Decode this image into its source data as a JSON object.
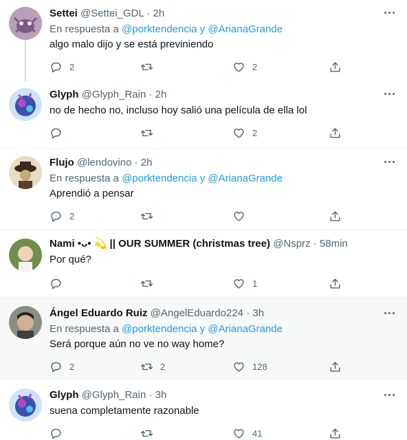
{
  "tweets": [
    {
      "name": "Settei",
      "handle": "@Settei_GDL",
      "time": "2h",
      "reply_prefix": "En respuesta a",
      "reply_users": "@porktendencia y @ArianaGrande",
      "text": "algo malo dijo y se está previniendo",
      "replies": "2",
      "retweets": "",
      "likes": "2"
    },
    {
      "name": "Glyph",
      "handle": "@Glyph_Rain",
      "time": "2h",
      "text": "no de hecho no, incluso hoy salió una película de ella lol",
      "replies": "",
      "retweets": "",
      "likes": "2"
    },
    {
      "name": "Flujo",
      "handle": "@lendovino",
      "time": "2h",
      "reply_prefix": "En respuesta a",
      "reply_users": "@porktendencia y @ArianaGrande",
      "text": "Aprendió a pensar",
      "replies": "2",
      "retweets": "",
      "likes": ""
    },
    {
      "name": "Nami •ᴗ• 💫 || OUR SUMMER (christmas tree)",
      "handle": "@Nsprz",
      "time": "58min",
      "text": "Por qué?",
      "replies": "",
      "retweets": "",
      "likes": "1"
    },
    {
      "name": "Ángel Eduardo Ruiz",
      "handle": "@AngelEduardo224",
      "time": "3h",
      "reply_prefix": "En respuesta a",
      "reply_users": "@porktendencia y @ArianaGrande",
      "text": "Será porque aún no ve no way home?",
      "replies": "2",
      "retweets": "2",
      "likes": "128"
    },
    {
      "name": "Glyph",
      "handle": "@Glyph_Rain",
      "time": "3h",
      "text": "suena completamente razonable",
      "replies": "",
      "retweets": "",
      "likes": "41"
    }
  ],
  "dot_separator": "·",
  "colors": {
    "link": "#1d9bf0",
    "secondary": "#536471",
    "highlight_bg": "#f7f9f9",
    "thread_line": "#cfd9de"
  },
  "icons": [
    "reply-icon",
    "retweet-icon",
    "like-icon",
    "share-icon",
    "more-icon"
  ]
}
